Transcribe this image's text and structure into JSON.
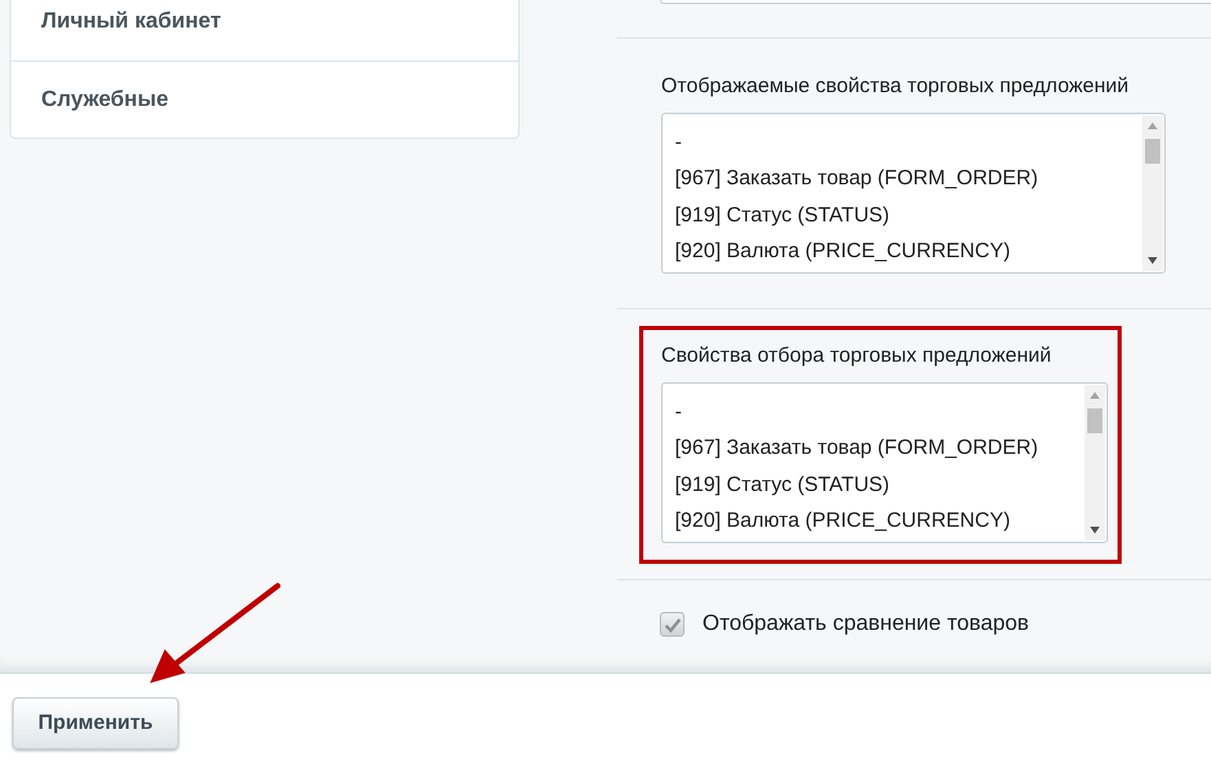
{
  "sidebar": {
    "items": [
      {
        "label": "Личный кабинет"
      },
      {
        "label": "Служебные"
      }
    ]
  },
  "sections": [
    {
      "kind": "listbox",
      "label": "Отображаемые свойства торговых предложений",
      "highlighted": false,
      "options": [
        "-",
        "[967] Заказать товар (FORM_ORDER)",
        "[919] Статус (STATUS)",
        "[920] Валюта (PRICE_CURRENCY)"
      ]
    },
    {
      "kind": "listbox",
      "label": "Свойства отбора торговых предложений",
      "highlighted": true,
      "options": [
        "-",
        "[967] Заказать товар (FORM_ORDER)",
        "[919] Статус (STATUS)",
        "[920] Валюта (PRICE_CURRENCY)"
      ]
    },
    {
      "kind": "checkbox",
      "label": "Отображать сравнение товаров",
      "checked": true
    }
  ],
  "apply_button": "Применить"
}
